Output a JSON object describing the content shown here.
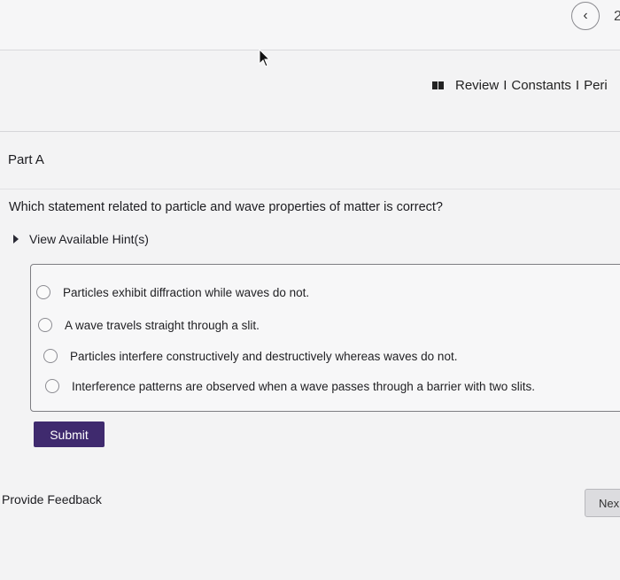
{
  "nav": {
    "cut_char": "2"
  },
  "toolbar": {
    "review": "Review",
    "separator": "I",
    "constants": "Constants",
    "periodic": "Peri"
  },
  "part": {
    "label": "Part A"
  },
  "question": {
    "text": "Which statement related to particle and wave properties of matter is correct?"
  },
  "hints": {
    "label": "View Available Hint(s)"
  },
  "options": [
    "Particles exhibit diffraction while waves do not.",
    "A wave travels straight through a slit.",
    "Particles interfere constructively and destructively whereas waves do not.",
    "Interference patterns are observed when a wave passes through a barrier with two slits."
  ],
  "submit": {
    "label": "Submit"
  },
  "feedback": {
    "label": "Provide Feedback"
  },
  "next": {
    "label": "Nex"
  },
  "colors": {
    "submit_bg": "#3f2a6e",
    "page_bg": "#f3f3f4"
  }
}
